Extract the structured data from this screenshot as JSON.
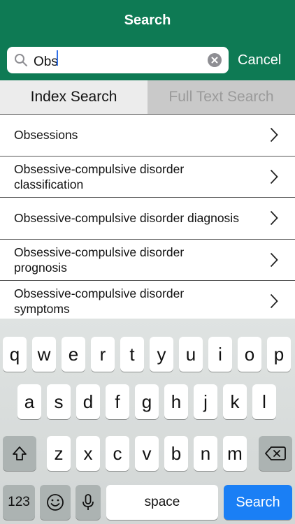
{
  "header": {
    "title": "Search"
  },
  "search": {
    "value": "Obs",
    "cancel_label": "Cancel"
  },
  "tabs": [
    {
      "label": "Index Search",
      "active": true
    },
    {
      "label": "Full Text Search",
      "active": false
    }
  ],
  "results": [
    {
      "label": "Obsessions"
    },
    {
      "label": "Obsessive-compulsive disorder classification"
    },
    {
      "label": "Obsessive-compulsive disorder diagnosis"
    },
    {
      "label": "Obsessive-compulsive disorder prognosis"
    },
    {
      "label": "Obsessive-compulsive disorder symptoms"
    }
  ],
  "keyboard": {
    "row1": [
      "q",
      "w",
      "e",
      "r",
      "t",
      "y",
      "u",
      "i",
      "o",
      "p"
    ],
    "row2": [
      "a",
      "s",
      "d",
      "f",
      "g",
      "h",
      "j",
      "k",
      "l"
    ],
    "row3": [
      "z",
      "x",
      "c",
      "v",
      "b",
      "n",
      "m"
    ],
    "numbers_label": "123",
    "space_label": "space",
    "search_label": "Search"
  },
  "colors": {
    "header": "#0e7a54",
    "search_key": "#1a7ff5"
  }
}
